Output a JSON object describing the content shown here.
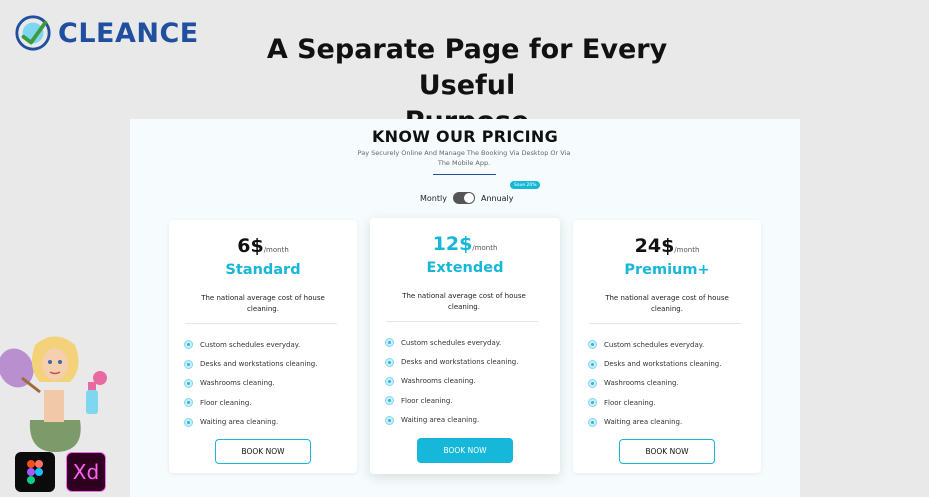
{
  "brand": {
    "name": "CLEANCE"
  },
  "headline": {
    "line1": "A Separate Page for Every Useful",
    "line2": "Purpose"
  },
  "pricing": {
    "title": "KNOW OUR PRICING",
    "subtitle": "Pay Securely Online And Manage The Booking Via Desktop Or Via The Mobile App.",
    "toggle": {
      "left_label": "Montly",
      "right_label": "Annualy",
      "badge": "Save 20%",
      "selected": "Annualy"
    },
    "plans": [
      {
        "price": "6$",
        "period": "/month",
        "name": "Standard",
        "description": "The national average cost of house cleaning.",
        "features": [
          "Custom schedules everyday.",
          "Desks and workstations cleaning.",
          "Washrooms cleaning.",
          "Floor cleaning.",
          "Waiting area cleaning."
        ],
        "button": "BOOK NOW"
      },
      {
        "price": "12$",
        "period": "/month",
        "name": "Extended",
        "description": "The national average cost of house cleaning.",
        "features": [
          "Custom schedules everyday.",
          "Desks and workstations cleaning.",
          "Washrooms cleaning.",
          "Floor cleaning.",
          "Waiting area cleaning."
        ],
        "button": "BOOK NOW"
      },
      {
        "price": "24$",
        "period": "/month",
        "name": "Premium+",
        "description": "The national average cost of house cleaning.",
        "features": [
          "Custom schedules everyday.",
          "Desks and workstations cleaning.",
          "Washrooms cleaning.",
          "Floor cleaning.",
          "Waiting area cleaning."
        ],
        "button": "BOOK NOW"
      }
    ]
  },
  "tools": {
    "xd_label": "Xd",
    "figma_icon": "figma-icon"
  },
  "colors": {
    "accent": "#16b7d9",
    "brand_blue": "#1f4f9e",
    "panel_bg": "#f6fcfd",
    "page_bg": "#e9e9e9"
  }
}
